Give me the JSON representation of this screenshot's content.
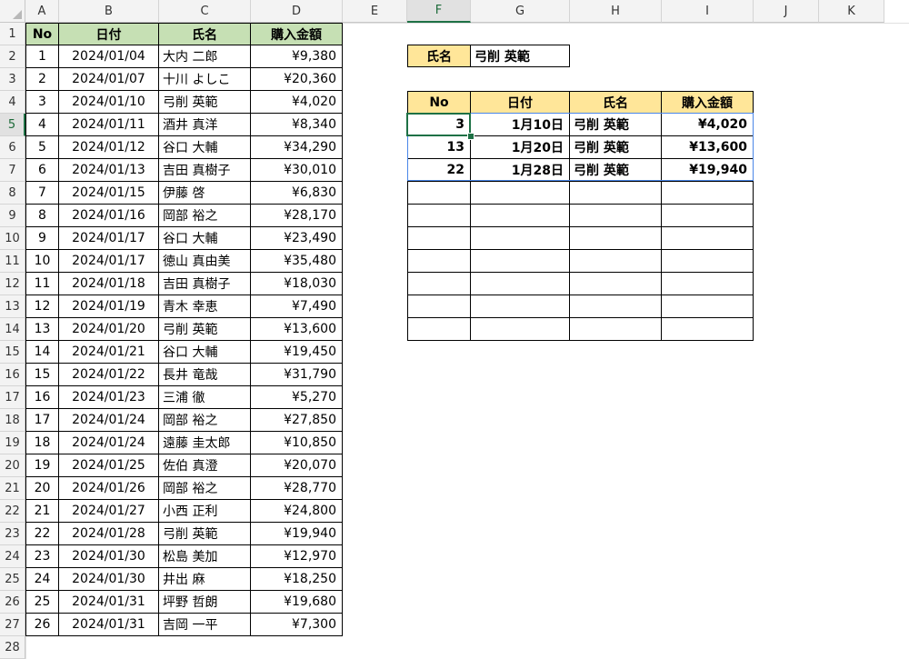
{
  "columns": [
    "A",
    "B",
    "C",
    "D",
    "E",
    "F",
    "G",
    "H",
    "I",
    "J",
    "K"
  ],
  "rows": [
    "1",
    "2",
    "3",
    "4",
    "5",
    "6",
    "7",
    "8",
    "9",
    "10",
    "11",
    "12",
    "13",
    "14",
    "15",
    "16",
    "17",
    "18",
    "19",
    "20",
    "21",
    "22",
    "23",
    "24",
    "25",
    "26",
    "27",
    "28"
  ],
  "source_table": {
    "headers": [
      "No",
      "日付",
      "氏名",
      "購入金額"
    ],
    "rows": [
      [
        "1",
        "2024/01/04",
        "大内 二郎",
        "¥9,380"
      ],
      [
        "2",
        "2024/01/07",
        "十川 よしこ",
        "¥20,360"
      ],
      [
        "3",
        "2024/01/10",
        "弓削 英範",
        "¥4,020"
      ],
      [
        "4",
        "2024/01/11",
        "酒井 真洋",
        "¥8,340"
      ],
      [
        "5",
        "2024/01/12",
        "谷口 大輔",
        "¥34,290"
      ],
      [
        "6",
        "2024/01/13",
        "吉田 真樹子",
        "¥30,010"
      ],
      [
        "7",
        "2024/01/15",
        "伊藤 啓",
        "¥6,830"
      ],
      [
        "8",
        "2024/01/16",
        "岡部 裕之",
        "¥28,170"
      ],
      [
        "9",
        "2024/01/17",
        "谷口 大輔",
        "¥23,490"
      ],
      [
        "10",
        "2024/01/17",
        "徳山 真由美",
        "¥35,480"
      ],
      [
        "11",
        "2024/01/18",
        "吉田 真樹子",
        "¥18,030"
      ],
      [
        "12",
        "2024/01/19",
        "青木 幸恵",
        "¥7,490"
      ],
      [
        "13",
        "2024/01/20",
        "弓削 英範",
        "¥13,600"
      ],
      [
        "14",
        "2024/01/21",
        "谷口 大輔",
        "¥19,450"
      ],
      [
        "15",
        "2024/01/22",
        "長井 竜哉",
        "¥31,790"
      ],
      [
        "16",
        "2024/01/23",
        "三浦 徹",
        "¥5,270"
      ],
      [
        "17",
        "2024/01/24",
        "岡部 裕之",
        "¥27,850"
      ],
      [
        "18",
        "2024/01/24",
        "遠藤 圭太郎",
        "¥10,850"
      ],
      [
        "19",
        "2024/01/25",
        "佐伯 真澄",
        "¥20,070"
      ],
      [
        "20",
        "2024/01/26",
        "岡部 裕之",
        "¥28,770"
      ],
      [
        "21",
        "2024/01/27",
        "小西 正利",
        "¥24,800"
      ],
      [
        "22",
        "2024/01/28",
        "弓削 英範",
        "¥19,940"
      ],
      [
        "23",
        "2024/01/30",
        "松島 美加",
        "¥12,970"
      ],
      [
        "24",
        "2024/01/30",
        "井出 麻",
        "¥18,250"
      ],
      [
        "25",
        "2024/01/31",
        "坪野 哲朗",
        "¥19,680"
      ],
      [
        "26",
        "2024/01/31",
        "吉岡 一平",
        "¥7,300"
      ]
    ]
  },
  "lookup": {
    "label": "氏名",
    "value": "弓削 英範"
  },
  "result_table": {
    "headers": [
      "No",
      "日付",
      "氏名",
      "購入金額"
    ],
    "rows": [
      [
        "3",
        "1月10日",
        "弓削 英範",
        "¥4,020"
      ],
      [
        "13",
        "1月20日",
        "弓削 英範",
        "¥13,600"
      ],
      [
        "22",
        "1月28日",
        "弓削 英範",
        "¥19,940"
      ]
    ],
    "empty_rows": 7
  },
  "selection": {
    "cell": "F5",
    "column": "F",
    "row": "5"
  },
  "colors": {
    "source_header": "#c6e0b4",
    "result_header": "#ffe699",
    "selection": "#1e7145",
    "spill_outline": "#4a86e8"
  }
}
